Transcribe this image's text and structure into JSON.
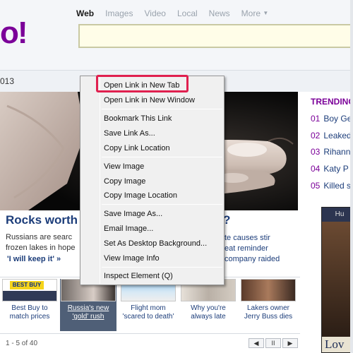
{
  "header": {
    "logo": "o!",
    "search_tabs": [
      {
        "label": "Web",
        "active": true
      },
      {
        "label": "Images",
        "active": false
      },
      {
        "label": "Video",
        "active": false
      },
      {
        "label": "Local",
        "active": false
      },
      {
        "label": "News",
        "active": false
      },
      {
        "label": "More",
        "active": false
      }
    ]
  },
  "date_fragment": "013",
  "story": {
    "headline": "Rocks worth",
    "headline_right": "?",
    "text": "Russians are searc frozen lakes in hope",
    "link": "'I will keep it'",
    "link_arrow": "»",
    "side_lines": [
      "te causes stir",
      "eat reminder",
      "company raided"
    ]
  },
  "thumbnails": [
    {
      "caption": "Best Buy to match prices",
      "selected": false
    },
    {
      "caption": "Russia's new 'gold' rush",
      "selected": true
    },
    {
      "caption": "Flight mom 'scared to death'",
      "selected": false
    },
    {
      "caption": "Why you're always late",
      "selected": false
    },
    {
      "caption": "Lakers owner Jerry Buss dies",
      "selected": false
    }
  ],
  "thumb_labels": {
    "bestbuy": "BEST BUY"
  },
  "pager": {
    "text": "1 - 5 of 40",
    "prev": "◀",
    "pause": "II",
    "next": "▶"
  },
  "trending": {
    "title": "TRENDING",
    "items": [
      {
        "num": "01",
        "text": "Boy Ge"
      },
      {
        "num": "02",
        "text": "Leaked"
      },
      {
        "num": "03",
        "text": "Rihanna"
      },
      {
        "num": "04",
        "text": "Katy P"
      },
      {
        "num": "05",
        "text": "Killed s"
      }
    ]
  },
  "ad": {
    "top": "Hu",
    "bottom": "Lov"
  },
  "context_menu": {
    "items": [
      "Open Link in New Tab",
      "Open Link in New Window",
      "Bookmark This Link",
      "Save Link As...",
      "Copy Link Location",
      "View Image",
      "Copy Image",
      "Copy Image Location",
      "Save Image As...",
      "Email Image...",
      "Set As Desktop Background...",
      "View Image Info",
      "Inspect Element (Q)"
    ],
    "highlighted": "Open Link in New Tab"
  },
  "colors": {
    "brand": "#7b0099",
    "link": "#1c3d7a",
    "highlight_box": "#e0204f"
  }
}
